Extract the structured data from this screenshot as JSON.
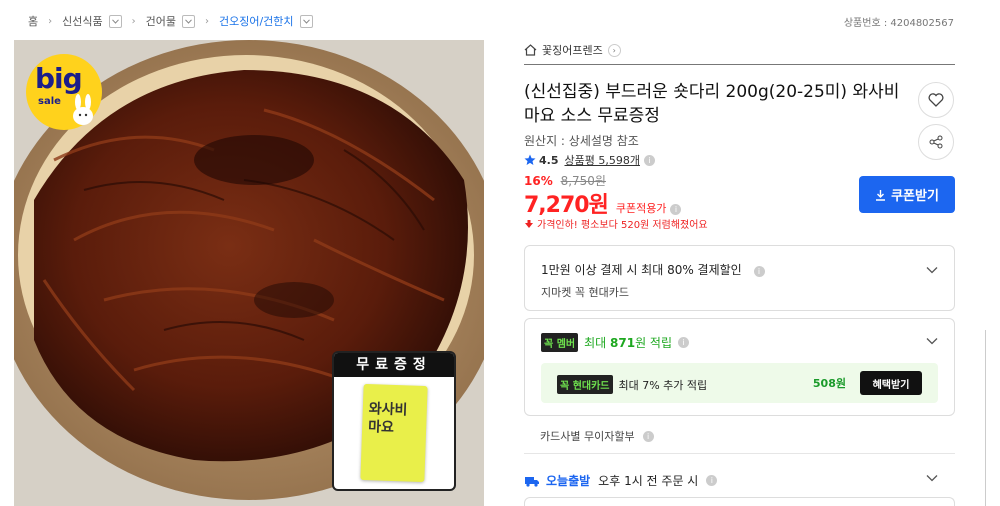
{
  "breadcrumb": {
    "home": "홈",
    "items": [
      "신선식품",
      "건어물",
      "건오징어/건한치"
    ]
  },
  "product_number": "상품번호 : 4204802567",
  "badge": {
    "big": "big",
    "sale": "sale"
  },
  "gift": {
    "title": "무료증정",
    "sachet": "와사비\n마요"
  },
  "store": {
    "name": "꽃징어프렌즈"
  },
  "product": {
    "title": "(신선집중) 부드러운 숏다리 200g(20-25미) 와사비마요 소스 무료증정",
    "origin": "원산지 : 상세설명 참조",
    "rating": "4.5",
    "review_label": "상품평 5,598개",
    "discount_pct": "16%",
    "original_price": "8,750원",
    "price": "7,270원",
    "coupon_note": "쿠폰적용가",
    "price_drop": "가격인하! 평소보다 520원 저렴해졌어요",
    "coupon_button": "쿠폰받기"
  },
  "payment_box": {
    "line1": "1만원 이상 결제 시 최대 80% 결제할인",
    "line2": "지마켓 꼭 현대카드"
  },
  "member_box": {
    "tag": "멤버",
    "tag_prefix": "꼭",
    "text_prefix": "최대",
    "points": "871",
    "text_suffix": "원 적립",
    "card_tag_prefix": "꼭",
    "card_tag": "현대카드",
    "card_text": "최대 7% 추가 적립",
    "card_amount": "508원",
    "benefit_button": "혜택받기"
  },
  "installment": "카드사별 무이자할부",
  "shipping": {
    "today": "오늘출발",
    "text": "오후 1시 전 주문 시"
  },
  "colors": {
    "accent": "#1c66f0",
    "sale": "#ff2222",
    "member": "#1ea820"
  },
  "icons": [
    "home-icon",
    "heart-icon",
    "share-icon",
    "download-icon",
    "star-icon",
    "truck-icon",
    "chevron-down-icon"
  ]
}
